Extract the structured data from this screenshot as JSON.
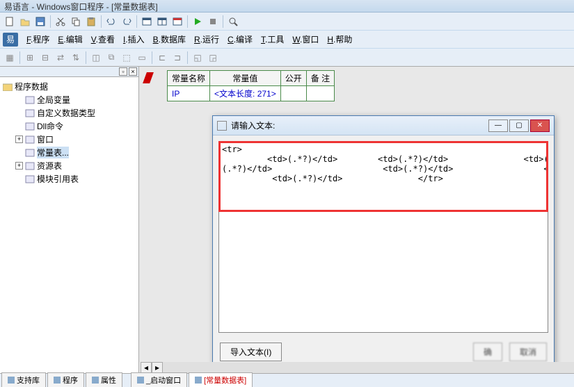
{
  "title": "易语言 - Windows窗口程序 - [常量数据表]",
  "menubar": {
    "items": [
      {
        "u": "F",
        "label": ".程序"
      },
      {
        "u": "E",
        "label": ".编辑"
      },
      {
        "u": "V",
        "label": ".查看"
      },
      {
        "u": "I",
        "label": ".插入"
      },
      {
        "u": "B",
        "label": ".数据库"
      },
      {
        "u": "R",
        "label": ".运行"
      },
      {
        "u": "C",
        "label": ".编译"
      },
      {
        "u": "T",
        "label": ".工具"
      },
      {
        "u": "W",
        "label": ".窗口"
      },
      {
        "u": "H",
        "label": ".帮助"
      }
    ]
  },
  "sidebar": {
    "root": "程序数据",
    "nodes": [
      {
        "label": "全局变量",
        "expandable": false
      },
      {
        "label": "自定义数据类型",
        "expandable": false
      },
      {
        "label": "Dll命令",
        "expandable": false
      },
      {
        "label": "窗口",
        "expandable": true
      },
      {
        "label": "常量表...",
        "expandable": false,
        "selected": true
      },
      {
        "label": "资源表",
        "expandable": true
      },
      {
        "label": "模块引用表",
        "expandable": false
      }
    ]
  },
  "const_table": {
    "headers": [
      "常量名称",
      "常量值",
      "公开",
      "备 注"
    ],
    "rows": [
      {
        "name": "IP",
        "value": "<文本长度: 271>",
        "public": "",
        "remark": ""
      }
    ]
  },
  "dialog": {
    "title": "请输入文本:",
    "content": "<tr>\n         <td>(.*?)</td>        <td>(.*?)</td>               <td>(.*?)</td>\n(.*?)</td>                      <td>(.*?)</td>                  <td>(.*?)</td>               <td>\n          <td>(.*?)</td>               </tr>",
    "import_btn": "导入文本(I)",
    "ok_btn": "确",
    "cancel_btn": "取消"
  },
  "bottom_tabs": {
    "left": [
      {
        "label": "支持库"
      },
      {
        "label": "程序"
      },
      {
        "label": "属性"
      }
    ],
    "right": [
      {
        "label": "_启动窗口"
      },
      {
        "label": "[常量数据表]",
        "active": true
      }
    ]
  }
}
